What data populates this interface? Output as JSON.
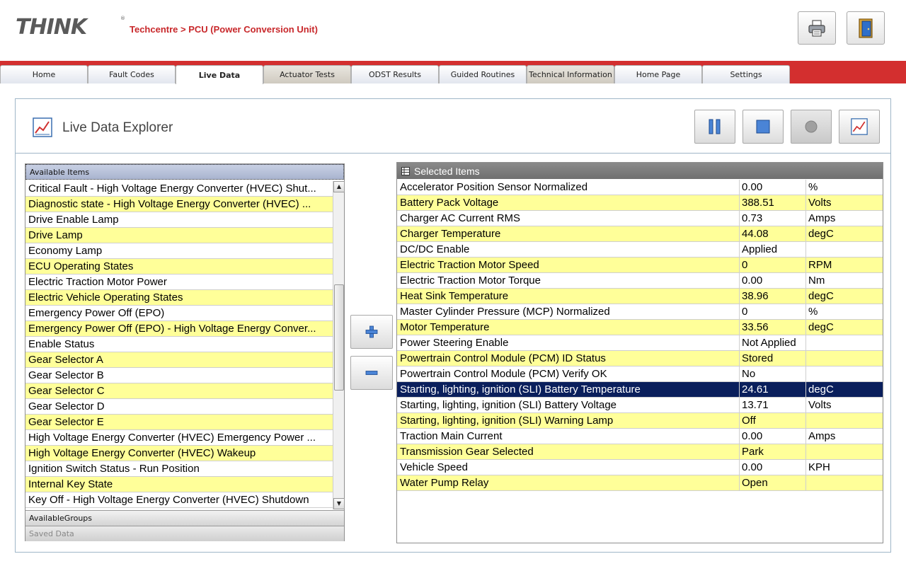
{
  "app": {
    "logo_text": "THINK",
    "breadcrumb": "Techcentre > PCU (Power Conversion Unit)"
  },
  "header_buttons": [
    {
      "icon": "printer-icon"
    },
    {
      "icon": "exit-door-icon"
    }
  ],
  "tabs": [
    {
      "label": "Home",
      "state": "normal"
    },
    {
      "label": "Fault Codes",
      "state": "normal"
    },
    {
      "label": "Live Data",
      "state": "active"
    },
    {
      "label": "Actuator Tests",
      "state": "alt"
    },
    {
      "label": "ODST Results",
      "state": "normal"
    },
    {
      "label": "Guided Routines",
      "state": "normal"
    },
    {
      "label": "Technical Information",
      "state": "alt"
    },
    {
      "label": "Home Page",
      "state": "normal"
    },
    {
      "label": "Settings",
      "state": "normal"
    }
  ],
  "panel": {
    "title": "Live Data Explorer",
    "controls": [
      {
        "icon": "pause-icon",
        "enabled": true
      },
      {
        "icon": "stop-icon",
        "enabled": true
      },
      {
        "icon": "record-icon",
        "enabled": false
      },
      {
        "icon": "chart-icon",
        "enabled": true
      }
    ]
  },
  "available": {
    "header": "Available Items",
    "items": [
      {
        "label": "Critical Fault - High Voltage Energy Converter (HVEC) Shut...",
        "y": false
      },
      {
        "label": "Diagnostic state - High Voltage Energy Converter (HVEC) ...",
        "y": true
      },
      {
        "label": "Drive Enable Lamp",
        "y": false
      },
      {
        "label": "Drive Lamp",
        "y": true
      },
      {
        "label": "Economy Lamp",
        "y": false
      },
      {
        "label": "ECU Operating States",
        "y": true
      },
      {
        "label": "Electric Traction Motor Power",
        "y": false
      },
      {
        "label": "Electric Vehicle Operating States",
        "y": true
      },
      {
        "label": "Emergency Power Off (EPO)",
        "y": false
      },
      {
        "label": "Emergency Power Off (EPO) - High Voltage Energy Conver...",
        "y": true
      },
      {
        "label": "Enable Status",
        "y": false
      },
      {
        "label": "Gear Selector A",
        "y": true
      },
      {
        "label": "Gear Selector B",
        "y": false
      },
      {
        "label": "Gear Selector C",
        "y": true
      },
      {
        "label": "Gear Selector D",
        "y": false
      },
      {
        "label": "Gear Selector E",
        "y": true
      },
      {
        "label": "High Voltage Energy Converter (HVEC) Emergency Power ...",
        "y": false
      },
      {
        "label": "High Voltage Energy Converter (HVEC) Wakeup",
        "y": true
      },
      {
        "label": "Ignition Switch Status - Run Position",
        "y": false
      },
      {
        "label": "Internal Key State",
        "y": true
      },
      {
        "label": "Key Off - High Voltage Energy Converter (HVEC) Shutdown",
        "y": false
      }
    ],
    "groups_label": "AvailableGroups",
    "saved_label": "Saved Data"
  },
  "selected": {
    "header": "Selected Items",
    "rows": [
      {
        "name": "Accelerator Position Sensor Normalized",
        "value": "0.00",
        "unit": "%",
        "style": "w"
      },
      {
        "name": "Battery Pack Voltage",
        "value": "388.51",
        "unit": "Volts",
        "style": "y"
      },
      {
        "name": "Charger AC Current RMS",
        "value": "0.73",
        "unit": "Amps",
        "style": "w"
      },
      {
        "name": "Charger Temperature",
        "value": "44.08",
        "unit": "degC",
        "style": "y"
      },
      {
        "name": "DC/DC Enable",
        "value": "Applied",
        "unit": "",
        "style": "w"
      },
      {
        "name": "Electric Traction Motor Speed",
        "value": "0",
        "unit": "RPM",
        "style": "y"
      },
      {
        "name": "Electric Traction Motor Torque",
        "value": "0.00",
        "unit": "Nm",
        "style": "w"
      },
      {
        "name": "Heat Sink Temperature",
        "value": "38.96",
        "unit": "degC",
        "style": "y"
      },
      {
        "name": "Master Cylinder Pressure (MCP) Normalized",
        "value": "0",
        "unit": "%",
        "style": "w"
      },
      {
        "name": "Motor Temperature",
        "value": "33.56",
        "unit": "degC",
        "style": "y"
      },
      {
        "name": "Power Steering Enable",
        "value": "Not Applied",
        "unit": "",
        "style": "w"
      },
      {
        "name": "Powertrain Control Module (PCM) ID Status",
        "value": "Stored",
        "unit": "",
        "style": "y"
      },
      {
        "name": "Powertrain Control Module (PCM) Verify OK",
        "value": "No",
        "unit": "",
        "style": "w"
      },
      {
        "name": "Starting, lighting, ignition (SLI) Battery Temperature",
        "value": "24.61",
        "unit": "degC",
        "style": "hl"
      },
      {
        "name": "Starting, lighting, ignition (SLI) Battery Voltage",
        "value": "13.71",
        "unit": "Volts",
        "style": "w"
      },
      {
        "name": "Starting, lighting, ignition (SLI) Warning Lamp",
        "value": "Off",
        "unit": "",
        "style": "y"
      },
      {
        "name": "Traction Main Current",
        "value": "0.00",
        "unit": "Amps",
        "style": "w"
      },
      {
        "name": "Transmission Gear Selected",
        "value": "Park",
        "unit": "",
        "style": "y"
      },
      {
        "name": "Vehicle Speed",
        "value": "0.00",
        "unit": "KPH",
        "style": "w"
      },
      {
        "name": "Water Pump Relay",
        "value": "Open",
        "unit": "",
        "style": "y"
      }
    ]
  },
  "colors": {
    "brand_red": "#d32f2f",
    "row_yellow": "#ffff99",
    "selection_navy": "#0a1f5c"
  }
}
